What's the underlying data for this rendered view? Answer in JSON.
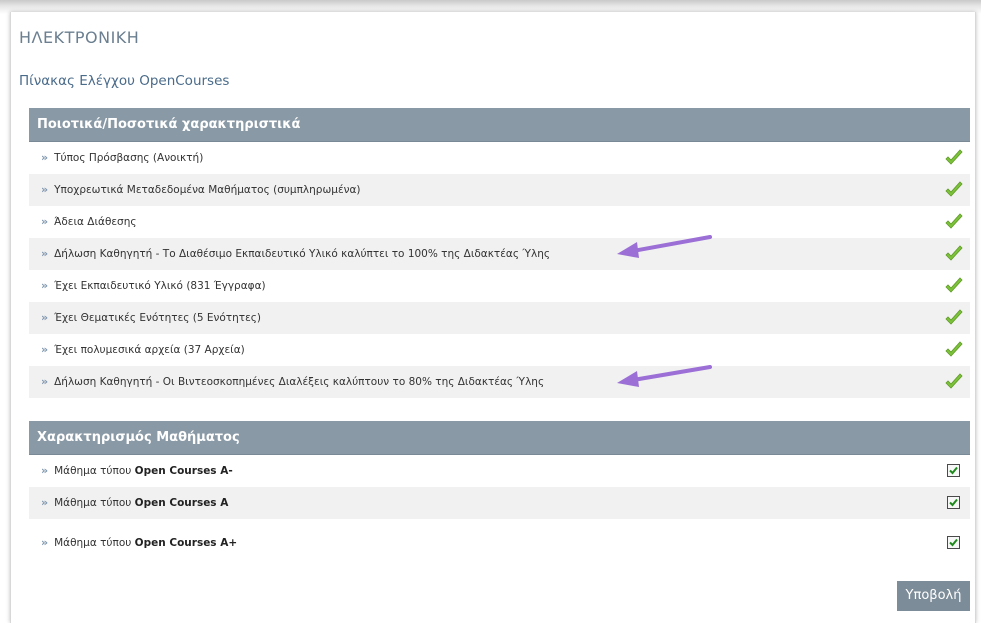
{
  "page": {
    "title": "ΗΛΕΚΤΡΟΝΙΚΗ",
    "subtitle": "Πίνακας Ελέγχου OpenCourses"
  },
  "section1": {
    "header": "Ποιοτικά/Ποσοτικά χαρακτηριστικά",
    "items": [
      {
        "label": "Τύπος Πρόσβασης (Ανοικτή)",
        "status": "passed"
      },
      {
        "label": "Υποχρεωτικά Μεταδεδομένα Μαθήματος (συμπληρωμένα)",
        "status": "passed"
      },
      {
        "label": "Άδεια Διάθεσης",
        "status": "passed"
      },
      {
        "label": "Δήλωση Καθηγητή - Το Διαθέσιμο Εκπαιδευτικό Υλικό καλύπτει το 100% της Διδακτέας Ύλης",
        "status": "passed"
      },
      {
        "label": "Έχει Εκπαιδευτικό Υλικό (831 Έγγραφα)",
        "status": "passed"
      },
      {
        "label": "Έχει Θεματικές Ενότητες (5 Ενότητες)",
        "status": "passed"
      },
      {
        "label": "Έχει πολυμεσικά αρχεία (37 Αρχεία)",
        "status": "passed"
      },
      {
        "label": "Δήλωση Καθηγητή - Οι Βιντεοσκοπημένες Διαλέξεις καλύπτουν το 80% της Διδακτέας Ύλης",
        "status": "passed"
      }
    ]
  },
  "section2": {
    "header": "Χαρακτηρισμός Μαθήματος",
    "items": [
      {
        "prefix": "Μάθημα τύπου",
        "course": "Open Courses A-",
        "checked": true
      },
      {
        "prefix": "Μάθημα τύπου",
        "course": "Open Courses A",
        "checked": true
      },
      {
        "prefix": "Μάθημα τύπου",
        "course": "Open Courses A+",
        "checked": true
      }
    ]
  },
  "submit_label": "Υποβολή",
  "colors": {
    "section_header_bg": "#8999a6",
    "check_green": "#7cc23a",
    "arrow_purple": "#9b6fd6",
    "submit_bg": "#7d8c99"
  }
}
